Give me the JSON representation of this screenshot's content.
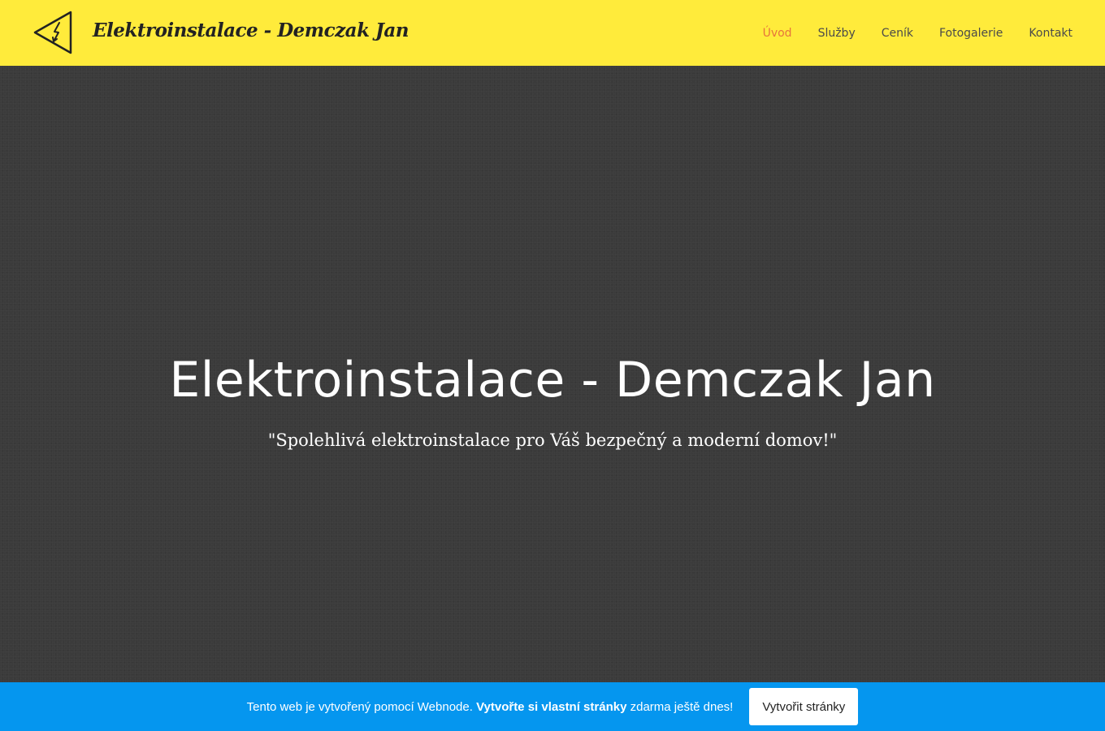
{
  "header": {
    "brand": "Elektroinstalace - Demczak Jan",
    "logo_icon": "high-voltage-triangle-icon",
    "nav": [
      {
        "label": "Úvod",
        "active": true
      },
      {
        "label": "Služby",
        "active": false
      },
      {
        "label": "Ceník",
        "active": false
      },
      {
        "label": "Fotogalerie",
        "active": false
      },
      {
        "label": "Kontakt",
        "active": false
      }
    ]
  },
  "hero": {
    "title": "Elektroinstalace - Demczak Jan",
    "subtitle": "\"Spolehlivá elektroinstalace pro Váš bezpečný a moderní domov!\""
  },
  "banner": {
    "text_before": "Tento web je vytvořený pomocí Webnode.",
    "text_bold": "Vytvořte si vlastní stránky",
    "text_after": "zdarma ještě dnes!",
    "button_label": "Vytvořit stránky"
  },
  "colors": {
    "header_bg": "#ffeb3b",
    "nav_active": "#e7743c",
    "hero_bg": "#3b3b3b",
    "banner_bg": "#0596ef"
  }
}
